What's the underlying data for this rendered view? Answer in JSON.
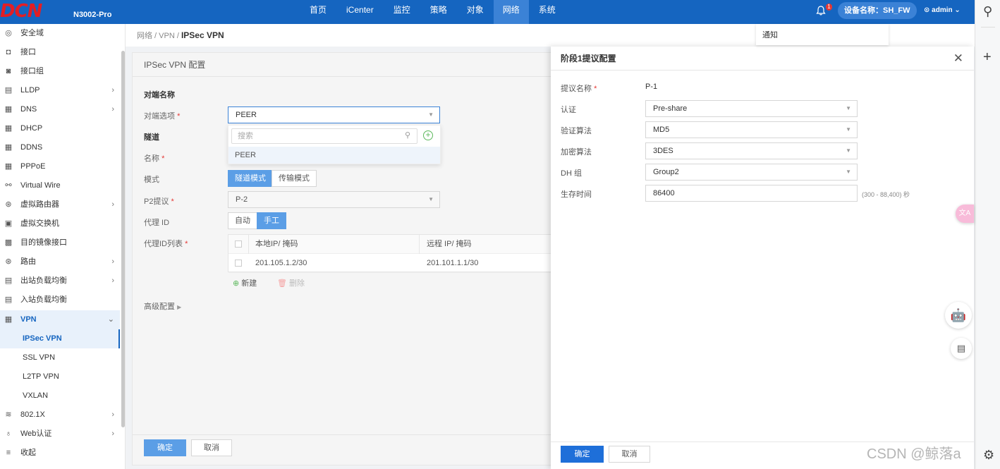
{
  "header": {
    "logo": "DCN",
    "model": "N3002-Pro",
    "nav": [
      "首页",
      "iCenter",
      "监控",
      "策略",
      "对象",
      "网络",
      "系统"
    ],
    "active_nav": "网络",
    "bell_badge": "1",
    "device": "设备名称：SH_FW",
    "user": "admin",
    "notify_popup": "通知"
  },
  "sidebar": {
    "items": [
      {
        "label": "安全域",
        "icon": "◎"
      },
      {
        "label": "接口",
        "icon": "◘"
      },
      {
        "label": "接口组",
        "icon": "◙"
      },
      {
        "label": "LLDP",
        "icon": "▤",
        "chevron": "›"
      },
      {
        "label": "DNS",
        "icon": "▦",
        "chevron": "›"
      },
      {
        "label": "DHCP",
        "icon": "▦"
      },
      {
        "label": "DDNS",
        "icon": "▦"
      },
      {
        "label": "PPPoE",
        "icon": "▦"
      },
      {
        "label": "Virtual Wire",
        "icon": "⚯"
      },
      {
        "label": "虚拟路由器",
        "icon": "⊛",
        "chevron": "›"
      },
      {
        "label": "虚拟交换机",
        "icon": "▣"
      },
      {
        "label": "目的镜像接口",
        "icon": "▩"
      },
      {
        "label": "路由",
        "icon": "⊛",
        "chevron": "›"
      },
      {
        "label": "出站负载均衡",
        "icon": "▤",
        "chevron": "›"
      },
      {
        "label": "入站负载均衡",
        "icon": "▤"
      },
      {
        "label": "VPN",
        "icon": "▦",
        "chevron": "⌄"
      },
      {
        "label": "IPSec VPN",
        "sub": true
      },
      {
        "label": "SSL VPN",
        "sub": true
      },
      {
        "label": "L2TP VPN",
        "sub": true
      },
      {
        "label": "VXLAN",
        "sub": true
      },
      {
        "label": "802.1X",
        "icon": "≋",
        "chevron": "›"
      },
      {
        "label": "Web认证",
        "icon": "♁",
        "chevron": "›"
      },
      {
        "label": "收起",
        "icon": "≡"
      }
    ]
  },
  "breadcrumb": {
    "prefix": "网络 / VPN / ",
    "current": "IPSec VPN"
  },
  "main": {
    "title": "IPSec VPN 配置",
    "peer_section": "对端名称",
    "peer_option_label": "对端选项",
    "peer_option_value": "PEER",
    "dropdown_search_placeholder": "搜索",
    "dropdown_option": "PEER",
    "tunnel_section": "隧道",
    "name_label": "名称",
    "mode_label": "模式",
    "mode_tunnel": "隧道模式",
    "mode_transport": "传输模式",
    "p2_label": "P2提议",
    "p2_value": "P-2",
    "proxy_id_label": "代理 ID",
    "proxy_auto": "自动",
    "proxy_manual": "手工",
    "proxy_list_label": "代理ID列表",
    "table": {
      "headers": [
        "本地IP/ 掩码",
        "远程 IP/ 掩码"
      ],
      "rows": [
        [
          "201.105.1.2/30",
          "201.101.1.1/30"
        ]
      ]
    },
    "add_label": "新建",
    "delete_label": "删除",
    "advanced_label": "高级配置",
    "ok": "确定",
    "cancel": "取消"
  },
  "drawer": {
    "title": "阶段1提议配置",
    "fields": {
      "proposal_name_label": "提议名称",
      "proposal_name_value": "P-1",
      "auth_label": "认证",
      "auth_value": "Pre-share",
      "hash_label": "验证算法",
      "hash_value": "MD5",
      "encrypt_label": "加密算法",
      "encrypt_value": "3DES",
      "dh_label": "DH 组",
      "dh_value": "Group2",
      "lifetime_label": "生存时间",
      "lifetime_value": "86400",
      "lifetime_hint": "(300 - 88,400) 秒"
    },
    "ok": "确定",
    "cancel": "取消"
  },
  "watermark": "CSDN @鲸落a"
}
